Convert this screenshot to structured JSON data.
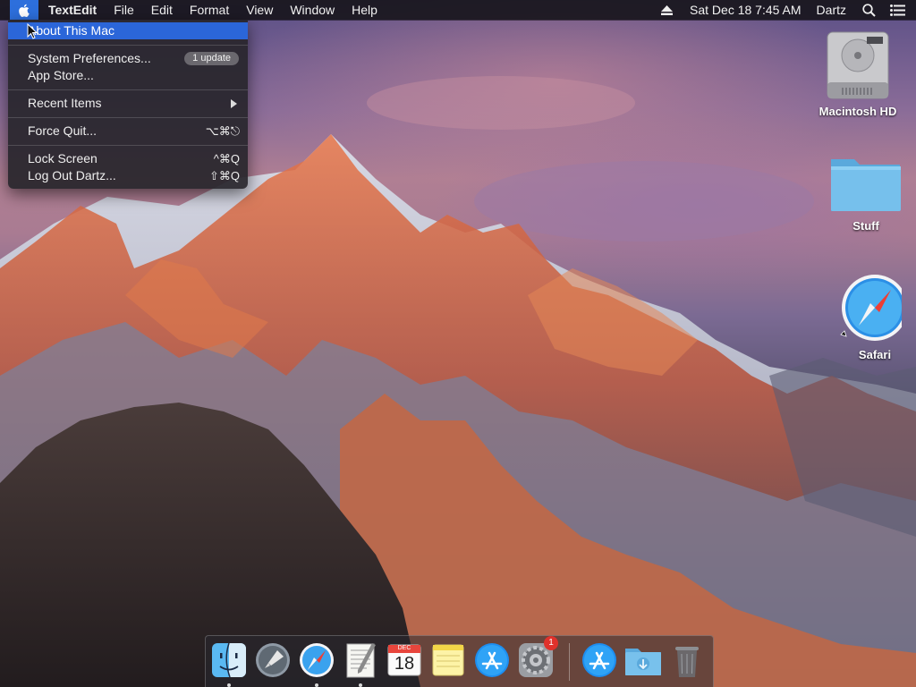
{
  "menubar": {
    "app_name": "TextEdit",
    "menus": [
      "File",
      "Edit",
      "Format",
      "View",
      "Window",
      "Help"
    ],
    "datetime": "Sat Dec 18  7:45 AM",
    "user": "Dartz"
  },
  "apple_menu": {
    "items": [
      {
        "label": "About This Mac"
      },
      {
        "label": "System Preferences...",
        "badge": "1 update"
      },
      {
        "label": "App Store..."
      },
      {
        "label": "Recent Items"
      },
      {
        "label": "Force Quit...",
        "shortcut": "⌥⌘⎋"
      },
      {
        "label": "Lock Screen",
        "shortcut": "^⌘Q"
      },
      {
        "label": "Log Out Dartz...",
        "shortcut": "⇧⌘Q"
      }
    ]
  },
  "desktop_icons": [
    {
      "label": "Macintosh HD",
      "icon": "hard-drive-icon"
    },
    {
      "label": "Stuff",
      "icon": "folder-icon"
    },
    {
      "label": "Safari",
      "icon": "safari-icon"
    }
  ],
  "dock": {
    "calendar_month": "DEC",
    "calendar_day": "18",
    "system_prefs_badge": "1",
    "items": [
      "finder-icon",
      "launchpad-icon",
      "safari-icon",
      "textedit-icon",
      "calendar-icon",
      "notes-icon",
      "app-store-icon",
      "system-preferences-icon",
      "applications-icon",
      "downloads-icon",
      "trash-icon"
    ]
  },
  "colors": {
    "highlight": "#2b66d9",
    "menu_bg": "#28262c",
    "badge_red": "#e0312b"
  }
}
